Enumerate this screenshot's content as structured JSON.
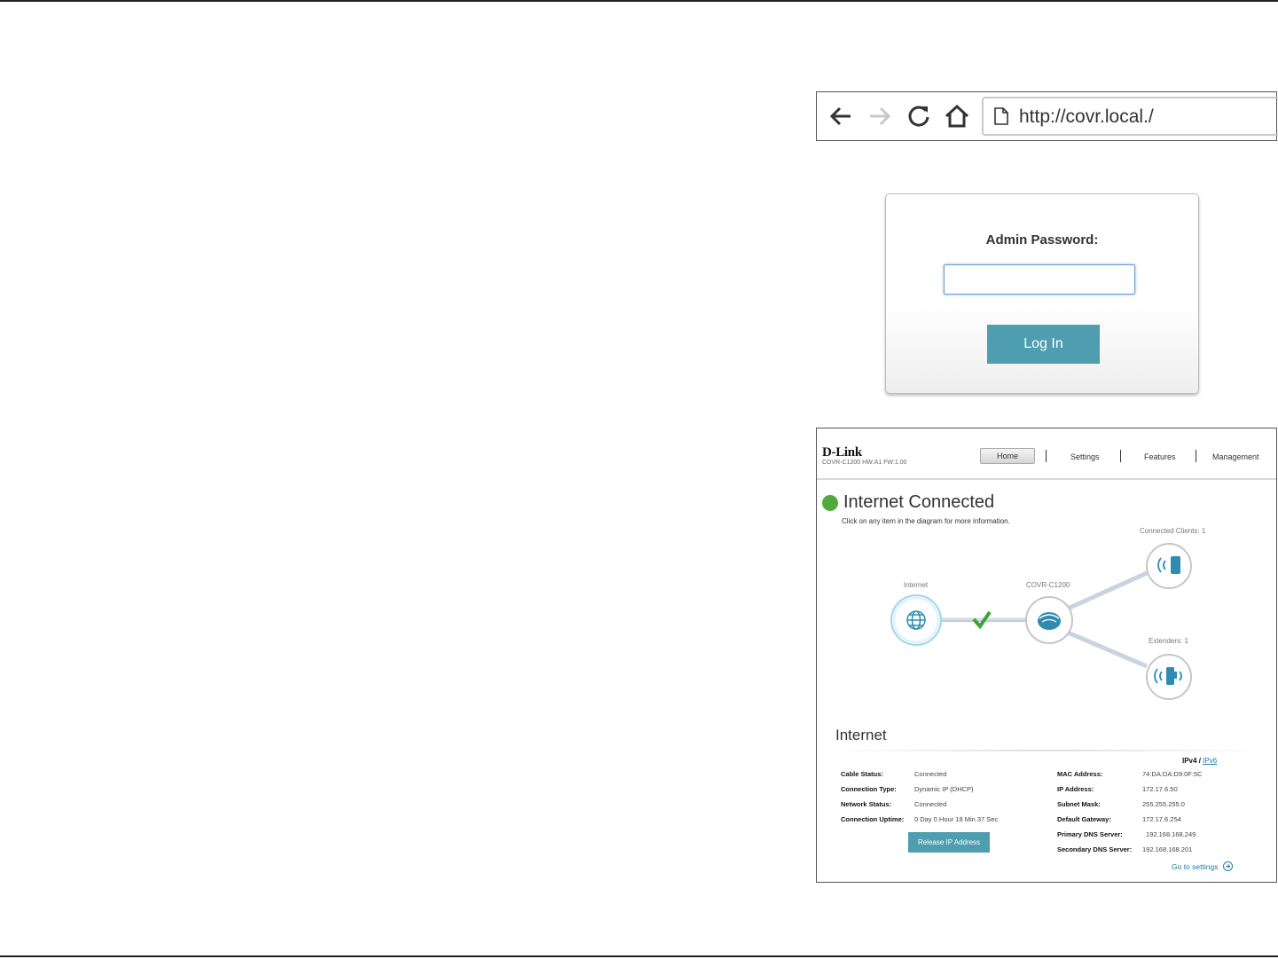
{
  "browser": {
    "url": "http://covr.local./"
  },
  "login": {
    "label": "Admin Password:",
    "password_value": "",
    "button_label": "Log In"
  },
  "dashboard": {
    "logo": "D-Link",
    "model_info": "COVR-C1200 HW:A1 FW:1.00",
    "nav": {
      "home": "Home",
      "settings": "Settings",
      "features": "Features",
      "management": "Management"
    },
    "status_title": "Internet Connected",
    "status_hint": "Click on any item in the diagram for more information.",
    "status_color": "#52a83b",
    "diagram": {
      "internet_label": "Internet",
      "device_label": "COVR-C1200",
      "clients_label": "Connected Clients: 1",
      "extenders_label": "Extenders: 1"
    },
    "section_title": "Internet",
    "ip_toggle": {
      "v4": "IPv4",
      "sep": "/",
      "v6": "IPv6"
    },
    "left_info": [
      {
        "label": "Cable Status:",
        "value": "Connected"
      },
      {
        "label": "Connection Type:",
        "value": "Dynamic IP (DHCP)"
      },
      {
        "label": "Network Status:",
        "value": "Connected"
      },
      {
        "label": "Connection Uptime:",
        "value": "0 Day 0 Hour 18 Min 37 Sec"
      }
    ],
    "right_info": [
      {
        "label": "MAC Address:",
        "value": "74:DA:DA:D9:0F:5C"
      },
      {
        "label": "IP Address:",
        "value": "172.17.6.50"
      },
      {
        "label": "Subnet Mask:",
        "value": "255.255.255.0"
      },
      {
        "label": "Default Gateway:",
        "value": "172.17.6.254"
      },
      {
        "label": "Primary DNS Server:",
        "value": "192.168.168.249"
      },
      {
        "label": "Secondary DNS Server:",
        "value": "192.168.168.201"
      }
    ],
    "release_button": "Release IP Address",
    "goto_settings": "Go to settings",
    "accent_color": "#4e9eaf"
  }
}
